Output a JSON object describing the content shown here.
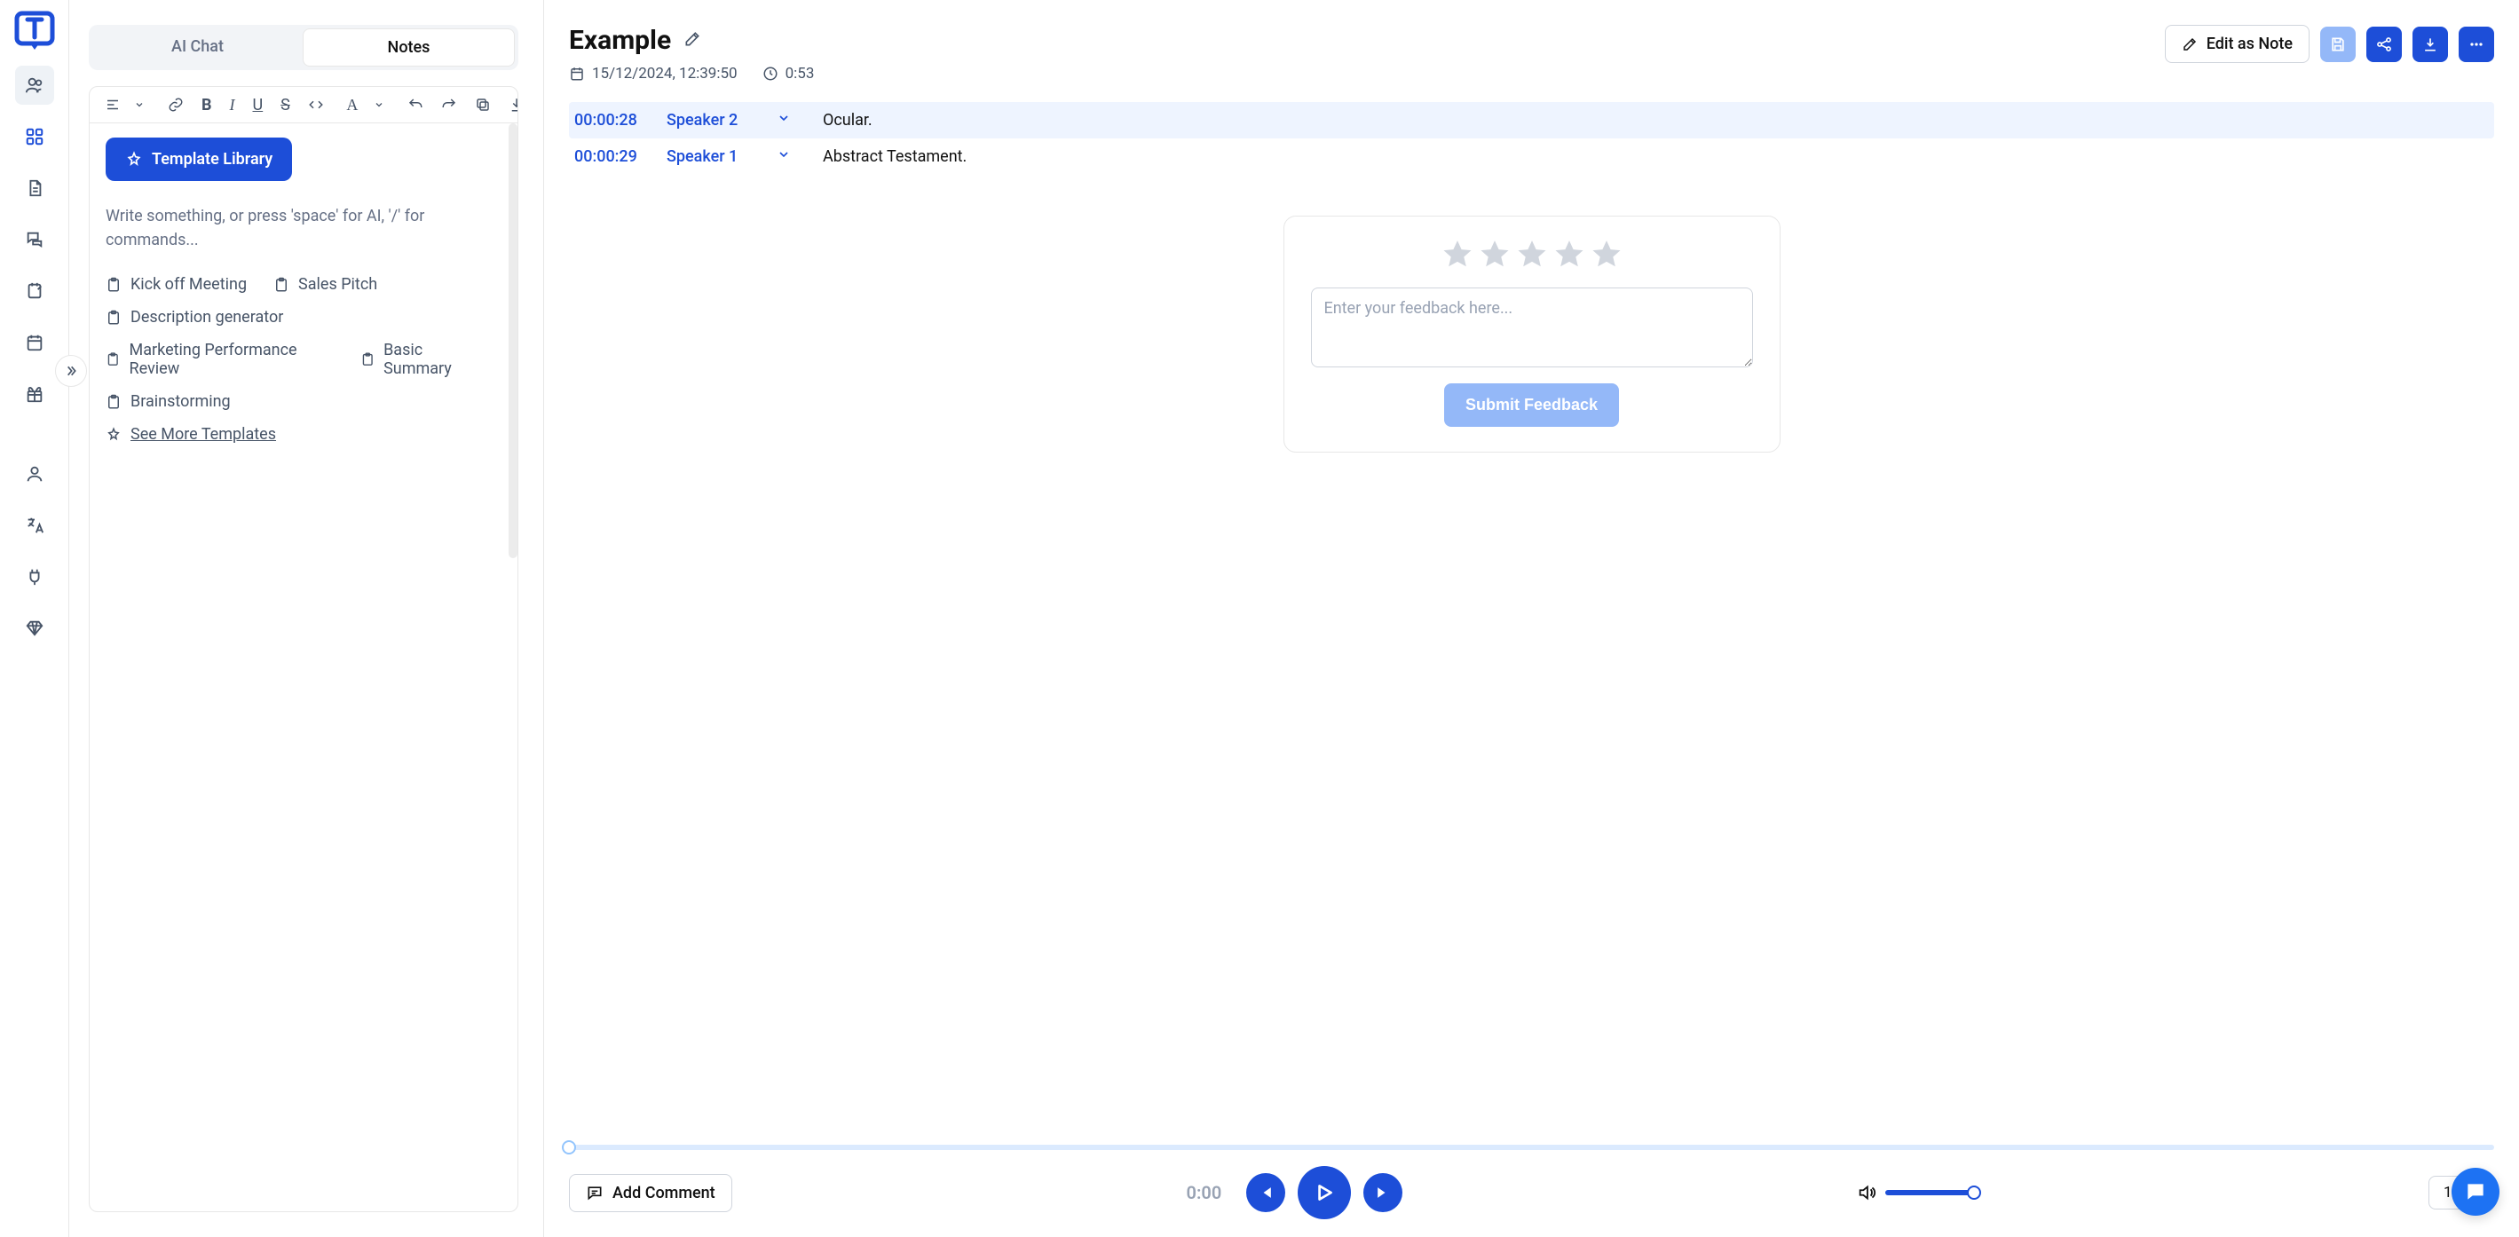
{
  "tabs": {
    "ai_chat": "AI Chat",
    "notes": "Notes"
  },
  "editor": {
    "template_library": "Template Library",
    "placeholder": "Write something, or press 'space' for AI, '/' for commands...",
    "templates": {
      "kick_off": "Kick off Meeting",
      "sales_pitch": "Sales Pitch",
      "description_gen": "Description generator",
      "marketing_review": "Marketing Performance Review",
      "basic_summary": "Basic Summary",
      "brainstorming": "Brainstorming"
    },
    "see_more": "See More Templates"
  },
  "document": {
    "title": "Example",
    "datetime": "15/12/2024, 12:39:50",
    "duration": "0:53"
  },
  "actions": {
    "edit_as_note": "Edit as Note"
  },
  "transcript": [
    {
      "time": "00:00:28",
      "speaker": "Speaker 2",
      "text": "Ocular."
    },
    {
      "time": "00:00:29",
      "speaker": "Speaker 1",
      "text": "Abstract Testament."
    }
  ],
  "feedback": {
    "placeholder": "Enter your feedback here...",
    "submit": "Submit Feedback"
  },
  "player": {
    "add_comment": "Add Comment",
    "current_time": "0:00",
    "speed": "1x"
  }
}
